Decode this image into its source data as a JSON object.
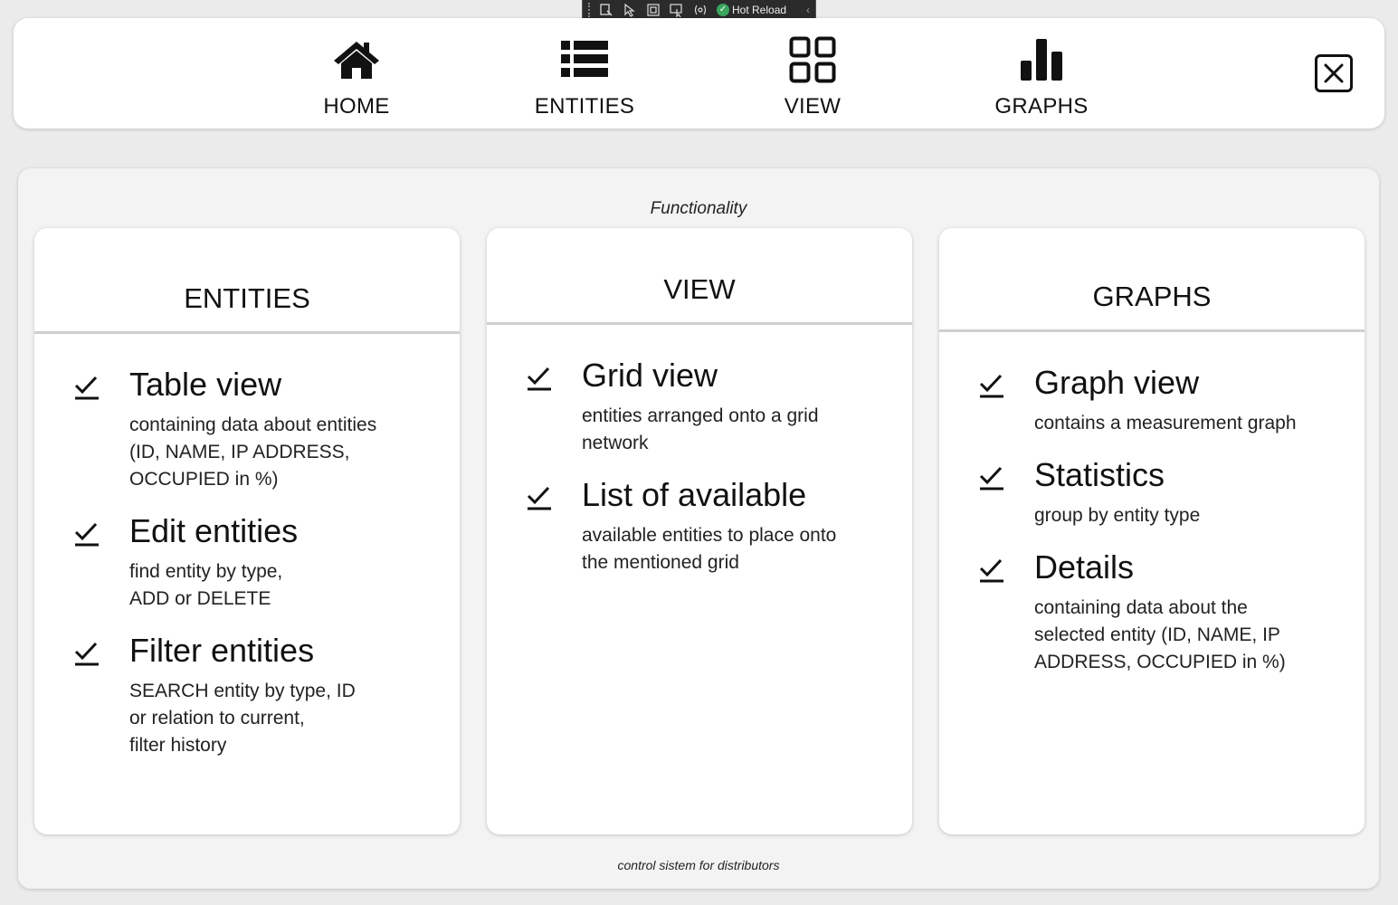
{
  "devbar": {
    "hot_reload_label": "Hot Reload"
  },
  "nav": {
    "items": [
      {
        "label": "HOME",
        "icon": "home-icon"
      },
      {
        "label": "ENTITIES",
        "icon": "list-icon"
      },
      {
        "label": "VIEW",
        "icon": "grid-icon"
      },
      {
        "label": "GRAPHS",
        "icon": "bar-chart-icon"
      }
    ],
    "close_icon": "close-icon"
  },
  "panel": {
    "title": "Functionality",
    "footer": "control sistem for distributors",
    "cards": [
      {
        "header": "ENTITIES",
        "features": [
          {
            "title": "Table view",
            "desc": "containing data about entities\n(ID, NAME, IP ADDRESS,\nOCCUPIED in %)"
          },
          {
            "title": "Edit entities",
            "desc": "find entity by type,\nADD or DELETE"
          },
          {
            "title": "Filter entities",
            "desc": "SEARCH entity by type, ID\nor relation to current,\nfilter history"
          }
        ]
      },
      {
        "header": "VIEW",
        "features": [
          {
            "title": "Grid view",
            "desc": "entities arranged onto a grid\nnetwork"
          },
          {
            "title": "List of available",
            "desc": "available entities to place onto\nthe mentioned grid"
          }
        ]
      },
      {
        "header": "GRAPHS",
        "features": [
          {
            "title": "Graph view",
            "desc": "contains a measurement graph"
          },
          {
            "title": "Statistics",
            "desc": "group by entity type"
          },
          {
            "title": "Details",
            "desc": "containing data about the\nselected entity (ID, NAME, IP\nADDRESS, OCCUPIED in %)"
          }
        ]
      }
    ]
  }
}
